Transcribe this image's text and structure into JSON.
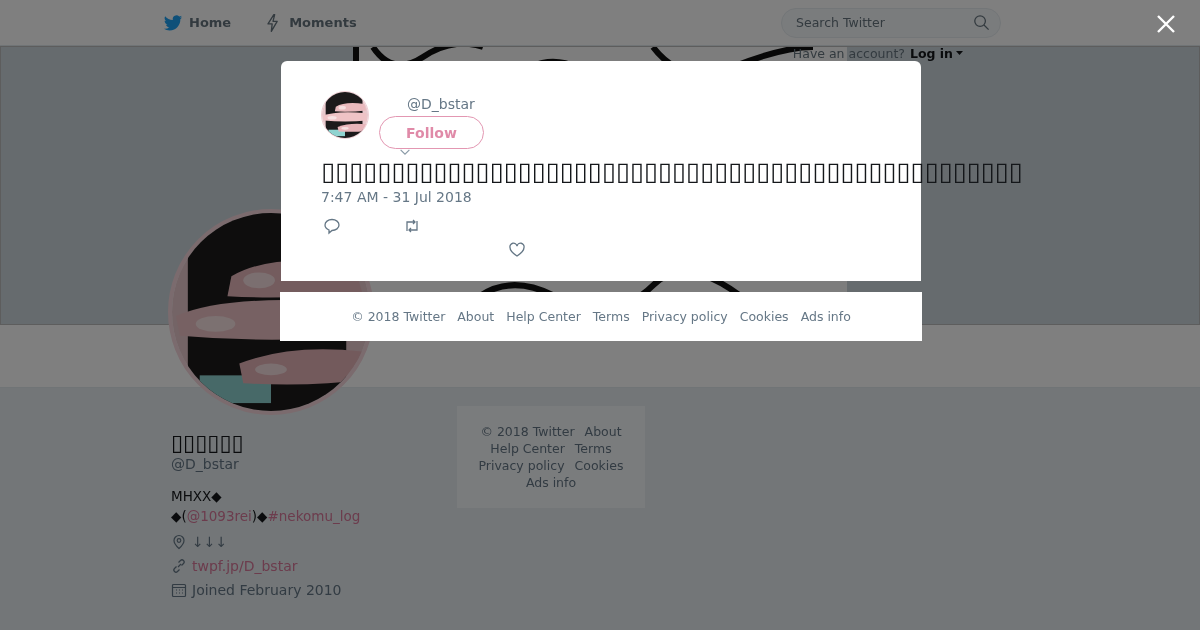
{
  "nav": {
    "items": [
      {
        "label": "Home",
        "kind": "bird"
      },
      {
        "label": "Moments",
        "kind": "bolt"
      }
    ]
  },
  "search": {
    "placeholder": "Search Twitter"
  },
  "login": {
    "prompt": "Have an account?",
    "link": "Log in"
  },
  "profile": {
    "name": "▯▯▯▯▯▯",
    "handle": "@D_bstar",
    "bio": [
      [
        {
          "text": "MHXX◆",
          "kind": "text"
        }
      ],
      [
        {
          "text": "◆(",
          "kind": "text"
        },
        {
          "text": "@1093rei",
          "kind": "link"
        },
        {
          "text": ")◆",
          "kind": "text"
        },
        {
          "text": "#nekomu_log",
          "kind": "link"
        }
      ]
    ],
    "location": "↓↓↓",
    "website": "twpf.jp/D_bstar",
    "joined": "Joined February 2010"
  },
  "side_footer": [
    "© 2018 Twitter",
    "About",
    "Help Center",
    "Terms",
    "Privacy policy",
    "Cookies",
    "Ads info"
  ],
  "modal": {
    "handle": "@D_bstar",
    "follow": "Follow",
    "text": "▯▯▯▯▯▯▯▯▯▯▯▯▯▯▯▯▯▯▯▯▯▯▯▯▯▯▯▯▯▯▯▯▯▯▯▯▯▯▯▯▯▯▯▯▯▯▯▯▯▯",
    "time": "7:47 AM - 31 Jul 2018",
    "footer": [
      "© 2018 Twitter",
      "About",
      "Help Center",
      "Terms",
      "Privacy policy",
      "Cookies",
      "Ads info"
    ]
  }
}
